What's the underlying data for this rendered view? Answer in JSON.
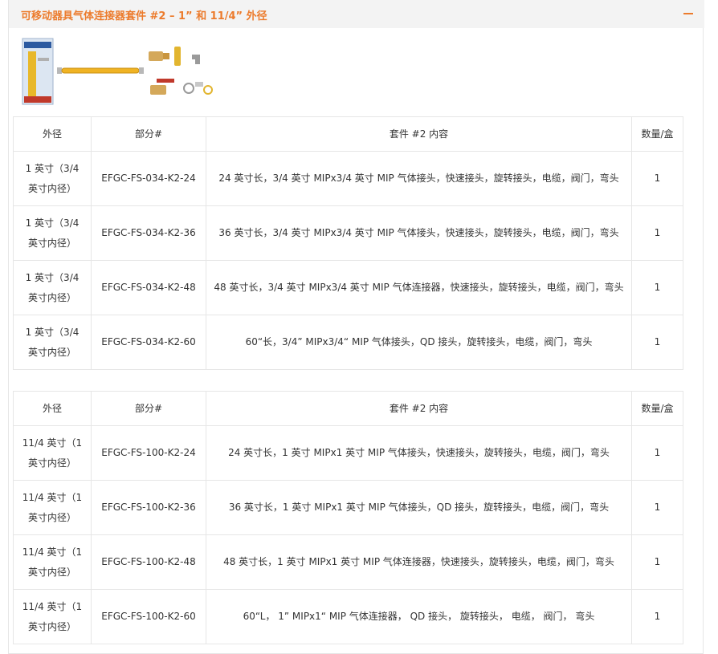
{
  "panel": {
    "title": "可移动器具气体连接器套件 #2 – 1” 和 11/4” 外径",
    "toggle_icon": "minus-icon",
    "accent_color": "#ec7b2c"
  },
  "image": {
    "alt": "gas-connector-kit-image"
  },
  "tables": [
    {
      "headers": [
        "外径",
        "部分#",
        "套件 #2 内容",
        "数量/盒"
      ],
      "rows": [
        [
          "1 英寸（3/4 英寸内径）",
          "EFGC-FS-034-K2-24",
          "24 英寸长，3/4 英寸 MIPx3/4 英寸 MIP 气体接头，快速接头，旋转接头，电缆，阀门，弯头",
          "1"
        ],
        [
          "1 英寸（3/4 英寸内径）",
          "EFGC-FS-034-K2-36",
          "36 英寸长，3/4 英寸 MIPx3/4 英寸 MIP 气体接头，快速接头，旋转接头，电缆，阀门，弯头",
          "1"
        ],
        [
          "1 英寸（3/4 英寸内径）",
          "EFGC-FS-034-K2-48",
          "48 英寸长，3/4 英寸 MIPx3/4 英寸 MIP 气体连接器，快速接头，旋转接头，电缆，阀门，弯头",
          "1"
        ],
        [
          "1 英寸（3/4 英寸内径）",
          "EFGC-FS-034-K2-60",
          "60“长，3/4” MIPx3/4“ MIP 气体接头，QD 接头，旋转接头，电缆，阀门，弯头",
          "1"
        ]
      ]
    },
    {
      "headers": [
        "外径",
        "部分#",
        "套件 #2 内容",
        "数量/盒"
      ],
      "rows": [
        [
          "11/4 英寸（1 英寸内径）",
          "EFGC-FS-100-K2-24",
          "24 英寸长，1 英寸 MIPx1 英寸 MIP 气体接头，快速接头，旋转接头，电缆，阀门，弯头",
          "1"
        ],
        [
          "11/4 英寸（1 英寸内径）",
          "EFGC-FS-100-K2-36",
          "36 英寸长，1 英寸 MIPx1 英寸 MIP 气体接头，QD 接头，旋转接头，电缆，阀门，弯头",
          "1"
        ],
        [
          "11/4 英寸（1 英寸内径）",
          "EFGC-FS-100-K2-48",
          "48 英寸长，1 英寸 MIPx1 英寸 MIP 气体连接器，快速接头，旋转接头，电缆，阀门，弯头",
          "1"
        ],
        [
          "11/4 英寸（1 英寸内径）",
          "EFGC-FS-100-K2-60",
          "60“L， 1” MIPx1“ MIP 气体连接器， QD 接头， 旋转接头， 电缆， 阀门， 弯头",
          "1"
        ]
      ]
    }
  ]
}
